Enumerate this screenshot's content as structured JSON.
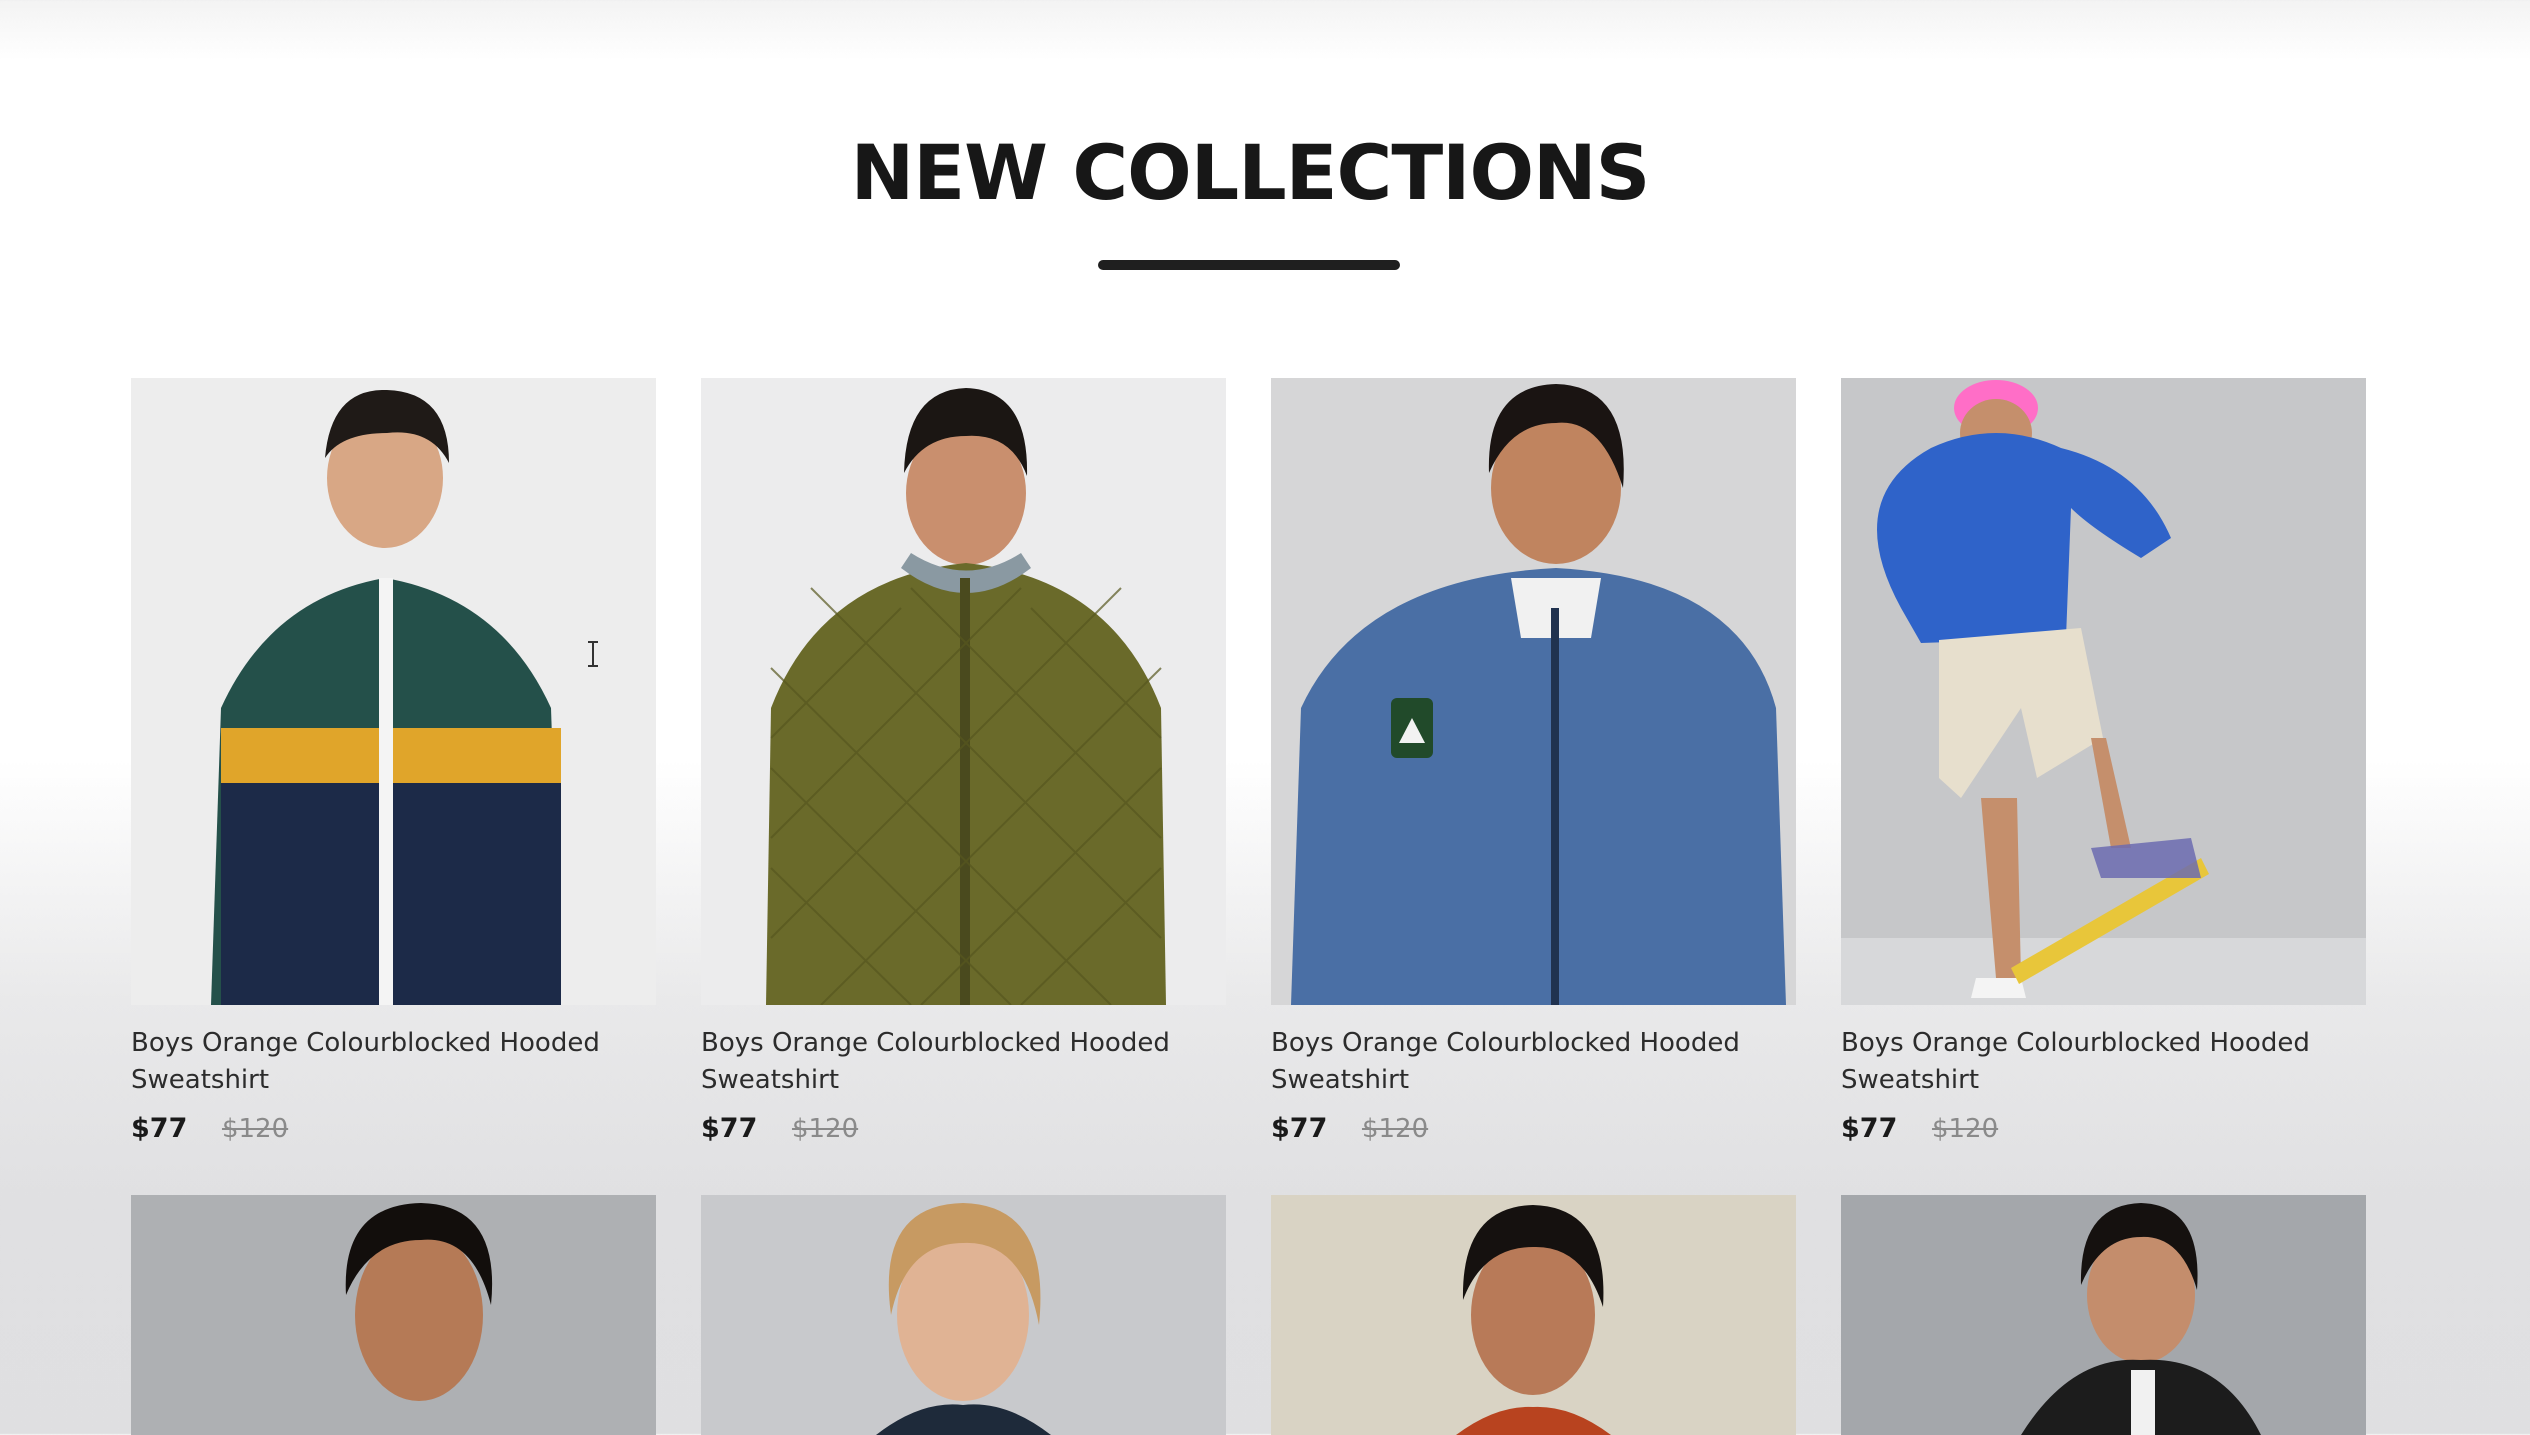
{
  "section": {
    "title": "NEW COLLECTIONS"
  },
  "products": [
    {
      "name": "Boys Orange Colourblocked Hooded Sweatshirt",
      "price": "$77",
      "old_price": "$120",
      "jacket_color": "#24504a"
    },
    {
      "name": "Boys Orange Colourblocked Hooded Sweatshirt",
      "price": "$77",
      "old_price": "$120",
      "jacket_color": "#6a6a2a"
    },
    {
      "name": "Boys Orange Colourblocked Hooded Sweatshirt",
      "price": "$77",
      "old_price": "$120",
      "jacket_color": "#4a6fa5"
    },
    {
      "name": "Boys Orange Colourblocked Hooded Sweatshirt",
      "price": "$77",
      "old_price": "$120",
      "jacket_color": "#2f63c9"
    }
  ],
  "products_row2": [
    {
      "jacket_color": "#2a2a2a"
    },
    {
      "jacket_color": "#1e2a3a"
    },
    {
      "jacket_color": "#b8431f"
    },
    {
      "jacket_color": "#1c1c1c"
    }
  ],
  "colors": {
    "title": "#171717",
    "price_old": "#8a8a8a",
    "card_bg": "#ececec"
  },
  "icons": {
    "cursor": "text-cursor-icon"
  }
}
